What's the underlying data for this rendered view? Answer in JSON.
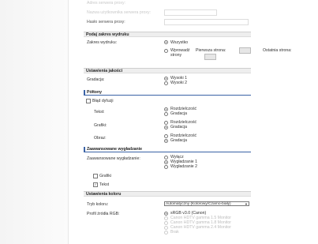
{
  "top": {
    "faded_label_0": "Adres serwera proxy:",
    "faded_label_1": "Nazwa użytkownika serwera proxy:",
    "proxy_password_label": "Hasło serwera proxy:"
  },
  "print_range": {
    "header": "Podaj zakres wydruku",
    "label": "Zakres wydruku:",
    "opt_all": "Wszystko",
    "opt_pages_line1": "Wprowadź",
    "opt_pages_line2": "strony",
    "first_page_label": "Pierwsza strona:",
    "last_page_label": "Ostatnia strona:"
  },
  "quality": {
    "header": "Ustawienia jakości",
    "label": "Gradacja:",
    "options": [
      "Wysoki 1",
      "Wysoki 2"
    ],
    "selected_index": 0
  },
  "halftones": {
    "header": "Półtony",
    "error_diffusion_label": "Błąd dyfuzji",
    "rows": [
      {
        "label": "Tekst:",
        "opt1": "Rozdzielczość",
        "opt2": "Gradacja",
        "selected": 0
      },
      {
        "label": "Grafiki:",
        "opt1": "Rozdzielczość",
        "opt2": "Gradacja",
        "selected": 1
      },
      {
        "label": "Obraz:",
        "opt1": "Rozdzielczość",
        "opt2": "Gradacja",
        "selected": 1
      }
    ]
  },
  "smoothing": {
    "header": "Zaawansowane wygładzanie",
    "label": "Zaawansowane wygładzanie:",
    "options": [
      "Wyłącz",
      "Wygładzanie 1",
      "Wygładzanie 2"
    ],
    "selected_index": 1,
    "graphics_label": "Grafiki",
    "graphics_checked": false,
    "text_label": "Tekst",
    "text_checked": true
  },
  "color": {
    "header": "Ustawienia koloru",
    "mode_label": "Tryb koloru:",
    "mode_value": "Automatyczny (Kolorowy/Czarno-biały)",
    "profile_label": "Profil źródła RGB:",
    "profiles": [
      "sRGB v3.0 (Canon)",
      "Canon HDTV gamma 1.5 Monitor",
      "Canon HDTV gamma 1.8 Monitor",
      "Canon HDTV gamma 2.4 Monitor",
      "Brak"
    ],
    "profile_selected": 0
  },
  "colors": {
    "accent": "#3a63a6",
    "section_bg": "#eeeeee"
  }
}
